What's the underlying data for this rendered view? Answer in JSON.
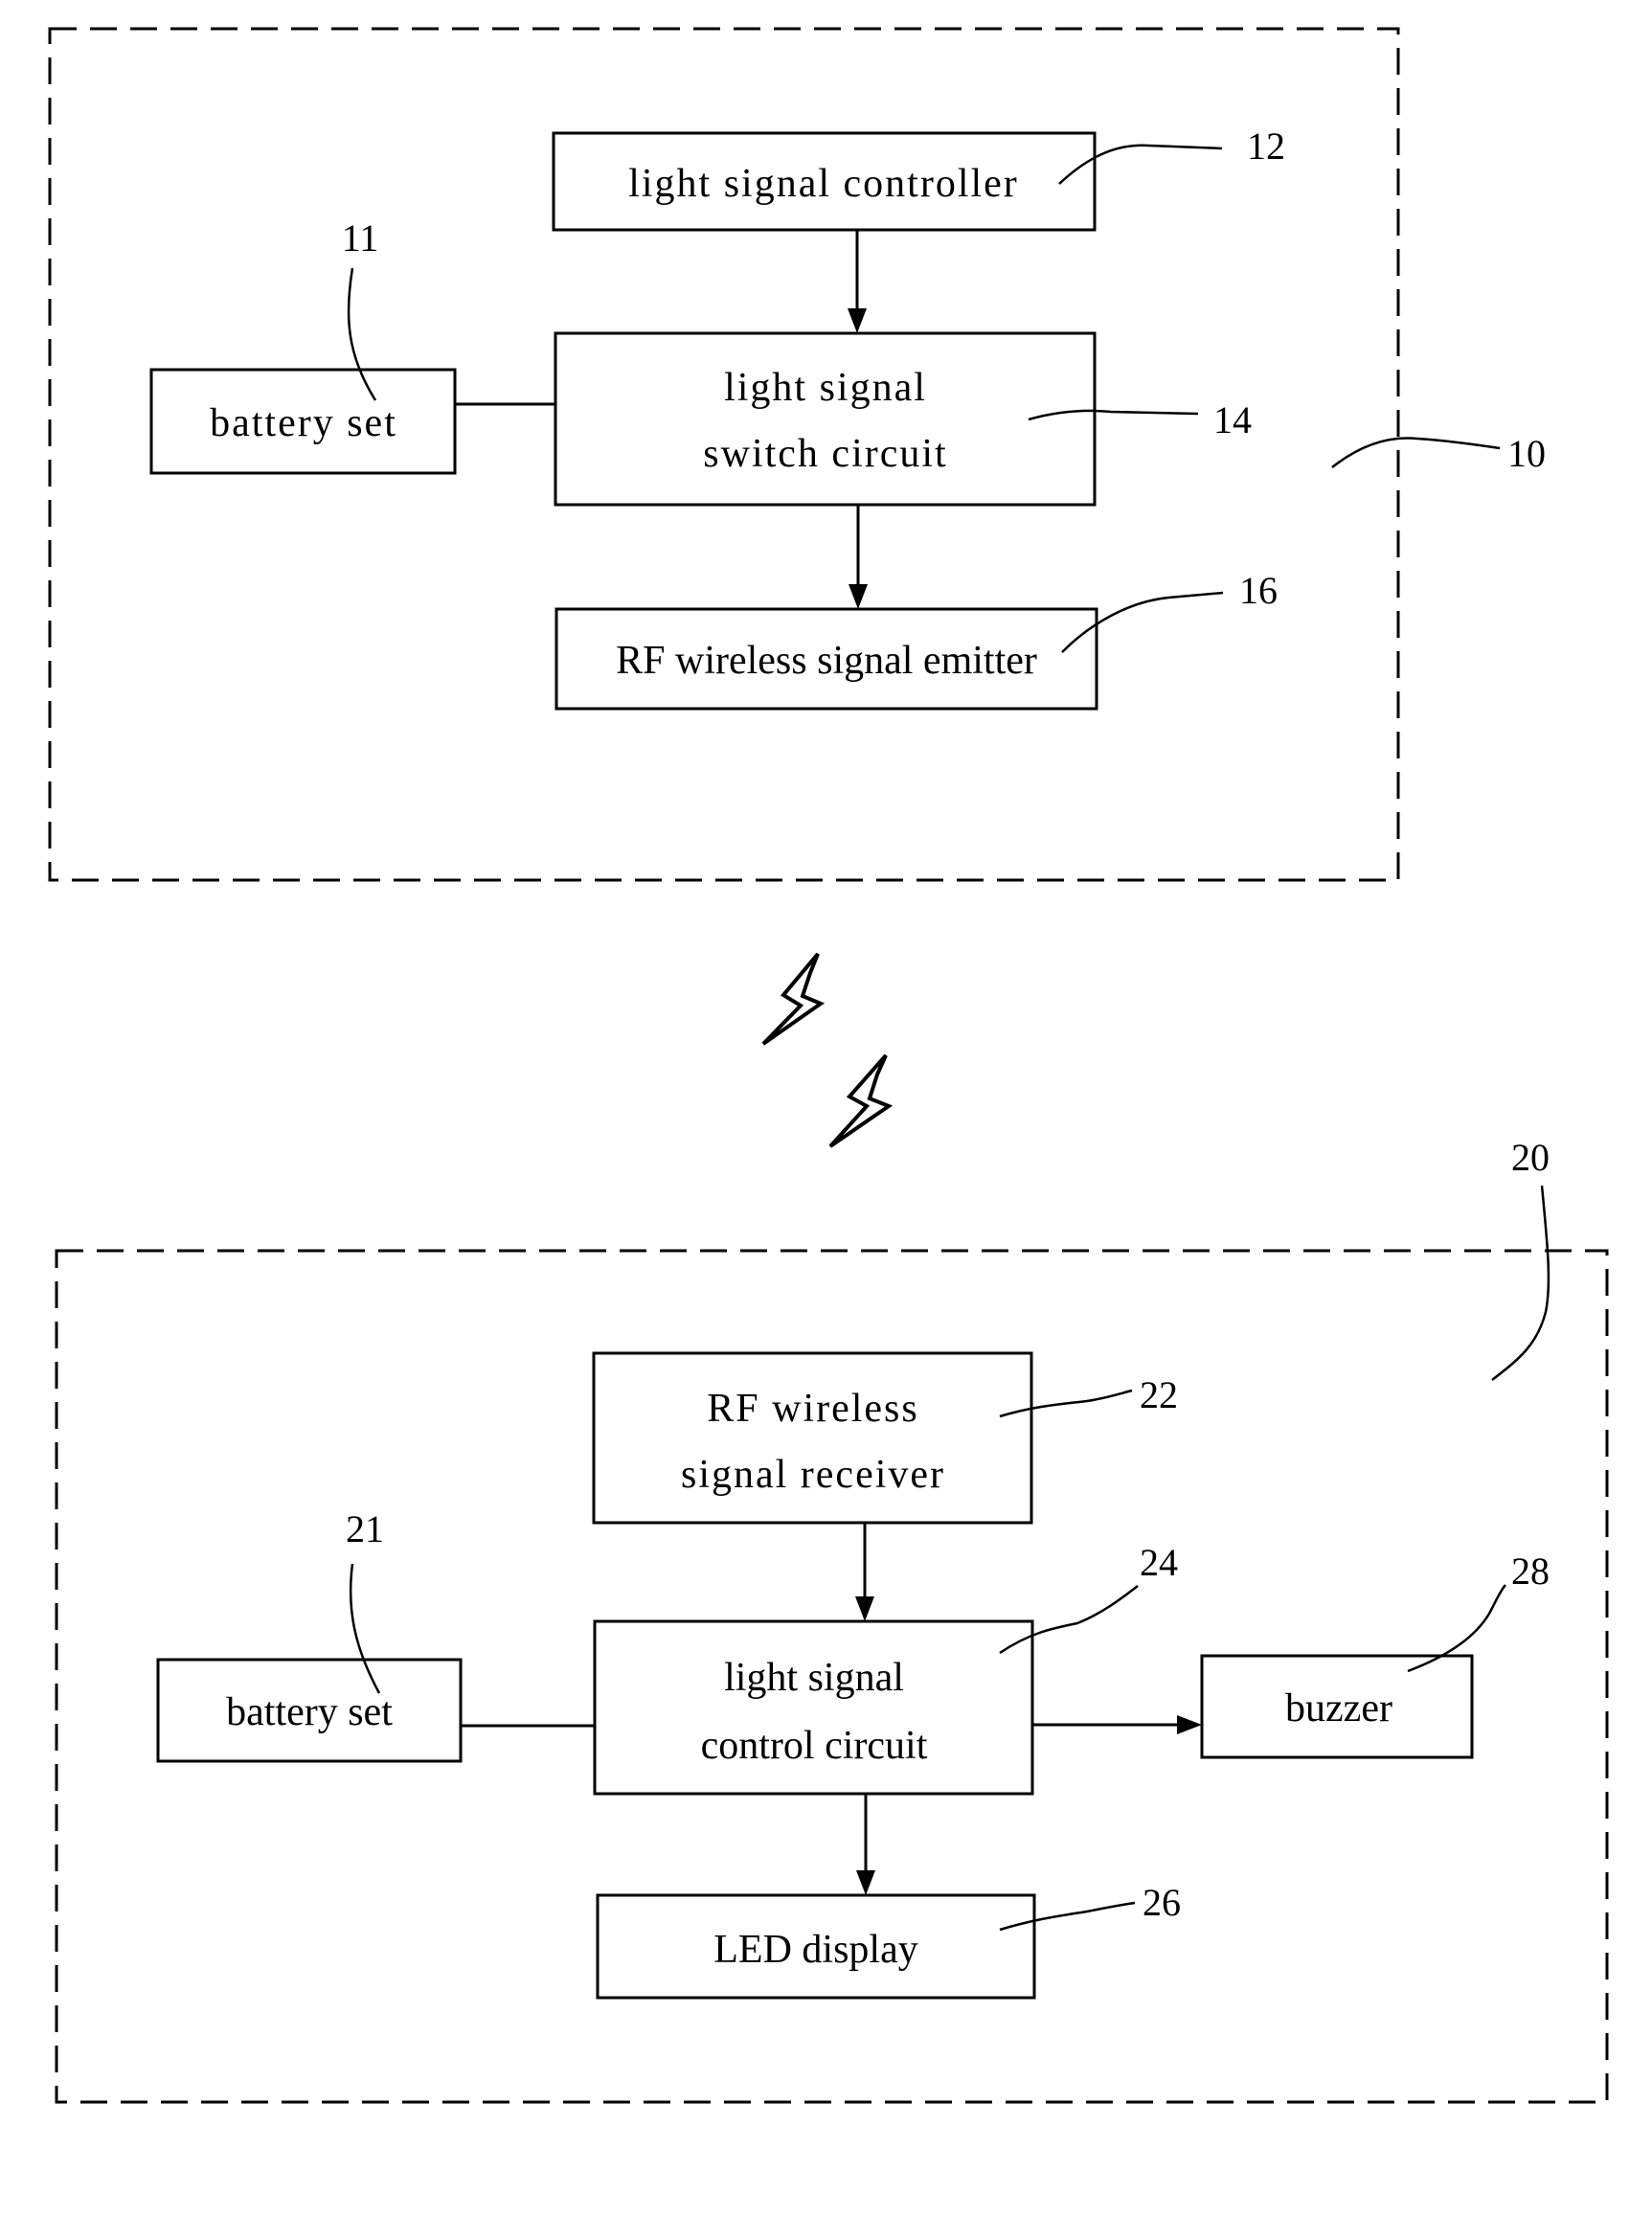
{
  "figure": {
    "emitter_unit": {
      "ref": "10",
      "battery": {
        "label": "battery set",
        "ref": "11"
      },
      "controller": {
        "label": "light signal controller",
        "ref": "12"
      },
      "switch_circuit": {
        "line1": "light signal",
        "line2": "switch circuit",
        "ref": "14"
      },
      "rf_emitter": {
        "label": "RF wireless signal emitter",
        "ref": "16"
      }
    },
    "receiver_unit": {
      "ref": "20",
      "battery": {
        "label": "battery set",
        "ref": "21"
      },
      "rf_receiver": {
        "line1": "RF wireless",
        "line2": "signal receiver",
        "ref": "22"
      },
      "control_circuit": {
        "line1": "light signal",
        "line2": "control circuit",
        "ref": "24"
      },
      "led_display": {
        "label": "LED display",
        "ref": "26"
      },
      "buzzer": {
        "label": "buzzer",
        "ref": "28"
      }
    },
    "wireless_link_icons": [
      "lightning-bolt",
      "lightning-bolt"
    ]
  }
}
